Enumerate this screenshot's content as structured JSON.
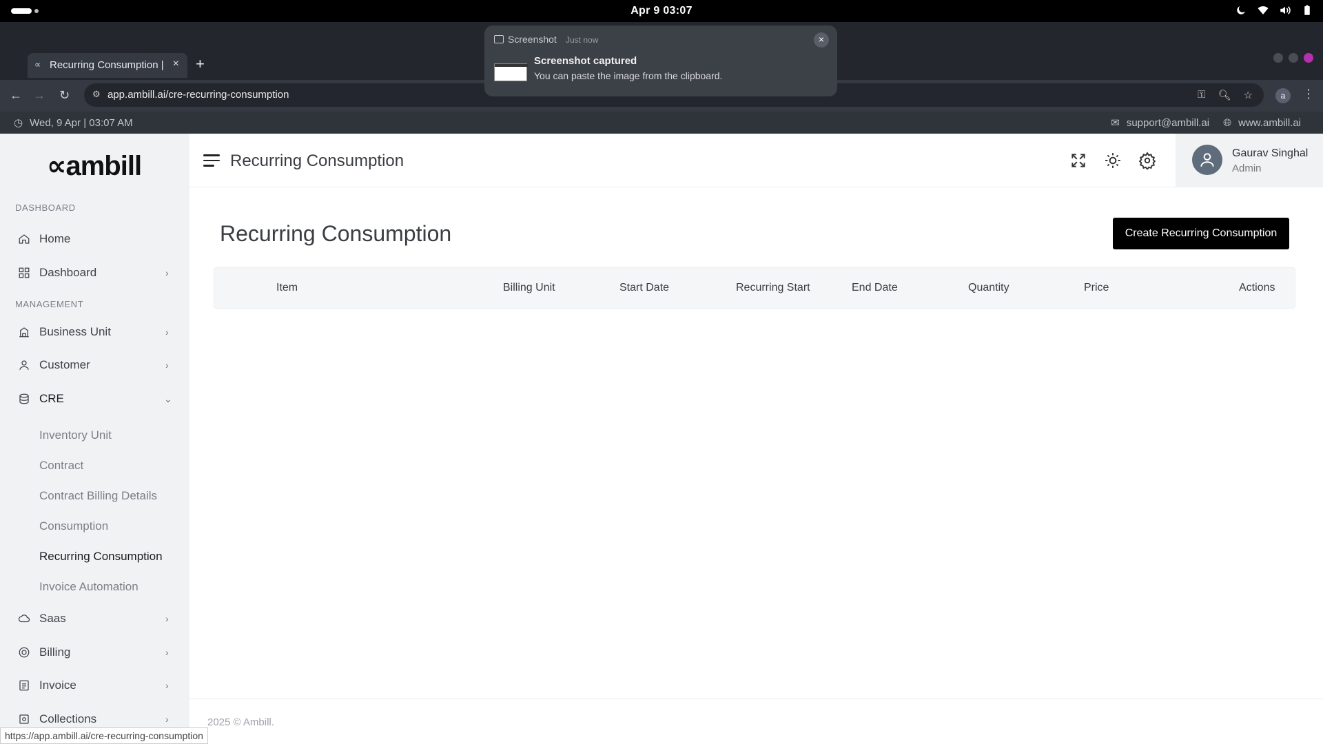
{
  "system": {
    "clock": "Apr 9  03:07"
  },
  "browser": {
    "tab_title": "Recurring Consumption |",
    "url": "app.ambill.ai/cre-recurring-consumption",
    "profile_initial": "a",
    "status_url": "https://app.ambill.ai/cre-recurring-consumption"
  },
  "notification": {
    "app": "Screenshot",
    "time": "Just now",
    "title": "Screenshot captured",
    "body": "You can paste the image from the clipboard."
  },
  "infostrip": {
    "datetime": "Wed, 9 Apr | 03:07 AM",
    "email": "support@ambill.ai",
    "website": "www.ambill.ai"
  },
  "sidebar": {
    "logo": "ambill",
    "section_dashboard": "DASHBOARD",
    "section_management": "MANAGEMENT",
    "home": "Home",
    "dashboard": "Dashboard",
    "business_unit": "Business Unit",
    "customer": "Customer",
    "cre": "CRE",
    "cre_children": [
      "Inventory Unit",
      "Contract",
      "Contract Billing Details",
      "Consumption",
      "Recurring Consumption",
      "Invoice Automation"
    ],
    "saas": "Saas",
    "billing": "Billing",
    "invoice": "Invoice",
    "collections": "Collections"
  },
  "header": {
    "title": "Recurring Consumption",
    "user_name": "Gaurav Singhal",
    "user_role": "Admin"
  },
  "main": {
    "title": "Recurring Consumption",
    "create_button": "Create Recurring Consumption",
    "columns": [
      "Item",
      "Billing Unit",
      "Start Date",
      "Recurring Start",
      "End Date",
      "Quantity",
      "Price",
      "Actions"
    ]
  },
  "footer": {
    "text": "2025 © Ambill."
  },
  "colors": {
    "accent": "#000000",
    "sidebar_bg": "#f1f2f4",
    "chrome_bg": "#23262c"
  }
}
